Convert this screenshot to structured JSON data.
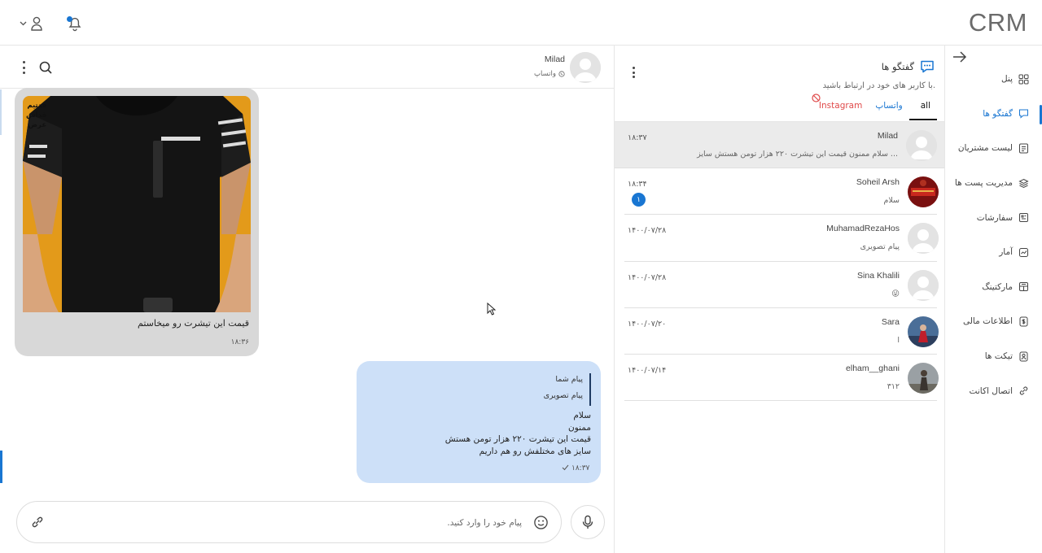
{
  "app": {
    "logo": "CRM"
  },
  "sidebar": {
    "items": [
      {
        "label": "پنل",
        "icon": "grid-icon"
      },
      {
        "label": "گفتگو ها",
        "icon": "chat-icon",
        "active": true
      },
      {
        "label": "لیست مشتریان",
        "icon": "list-icon"
      },
      {
        "label": "مدیریت پست ها",
        "icon": "layers-icon"
      },
      {
        "label": "سفارشات",
        "icon": "orders-icon"
      },
      {
        "label": "آمار",
        "icon": "stats-icon"
      },
      {
        "label": "مارکتینگ",
        "icon": "marketing-icon"
      },
      {
        "label": "اطلاعات مالی",
        "icon": "money-icon"
      },
      {
        "label": "تیکت ها",
        "icon": "ticket-icon"
      },
      {
        "label": "اتصال اکانت",
        "icon": "link-account-icon"
      }
    ]
  },
  "conversations": {
    "title": "گفتگو ها",
    "subtitle": "با کاربر های خود در ارتباط باشید.",
    "tabs": {
      "all": "all",
      "whatsapp": "واتساپ",
      "instagram": "Instagram"
    },
    "items": [
      {
        "name": "Milad",
        "snippet": "سلام ممنون قیمت این تیشرت ۲۲۰ هزار تومن هستش سایز ...",
        "time": "۱۸:۳۷",
        "selected": true,
        "avatar": "default"
      },
      {
        "name": "Soheil Arsh",
        "snippet": "سلام",
        "time": "۱۸:۳۴",
        "badge": "۱",
        "avatar": "red"
      },
      {
        "name": "MuhamadRezaHos",
        "snippet": "پیام تصویری",
        "time": "۱۴۰۰/۰۷/۲۸",
        "avatar": "default"
      },
      {
        "name": "Sina Khalili",
        "snippet": "😜",
        "time": "۱۴۰۰/۰۷/۲۸",
        "avatar": "default"
      },
      {
        "name": "Sara",
        "snippet": "ا",
        "time": "۱۴۰۰/۰۷/۲۰",
        "avatar": "sara"
      },
      {
        "name": "elham__ghani",
        "snippet": "۳۱۲",
        "time": "۱۴۰۰/۰۷/۱۴",
        "avatar": "elham"
      }
    ]
  },
  "chat": {
    "contact_name": "Milad",
    "channel": "واتساپ",
    "incoming": {
      "image_text": [
        "قدتیم",
        "قدآس",
        "عرض"
      ],
      "caption": "قیمت این تیشرت رو میخاستم",
      "time": "۱۸:۳۶"
    },
    "outgoing": {
      "reply_to_author": "پیام شما",
      "reply_to_text": "پیام تصویری",
      "lines": [
        "سلام",
        "ممنون",
        "قیمت این تیشرت ۲۲۰ هزار تومن هستش",
        "سایز های مختلفش رو هم داریم"
      ],
      "time": "۱۸:۳۷"
    },
    "composer": {
      "placeholder": "پیام خود را وارد کنید."
    }
  },
  "colors": {
    "accent": "#1976d2",
    "outgoing_bubble": "#cde0f8",
    "incoming_bubble": "#d8d8d8",
    "instagram": "#e04a4a"
  }
}
